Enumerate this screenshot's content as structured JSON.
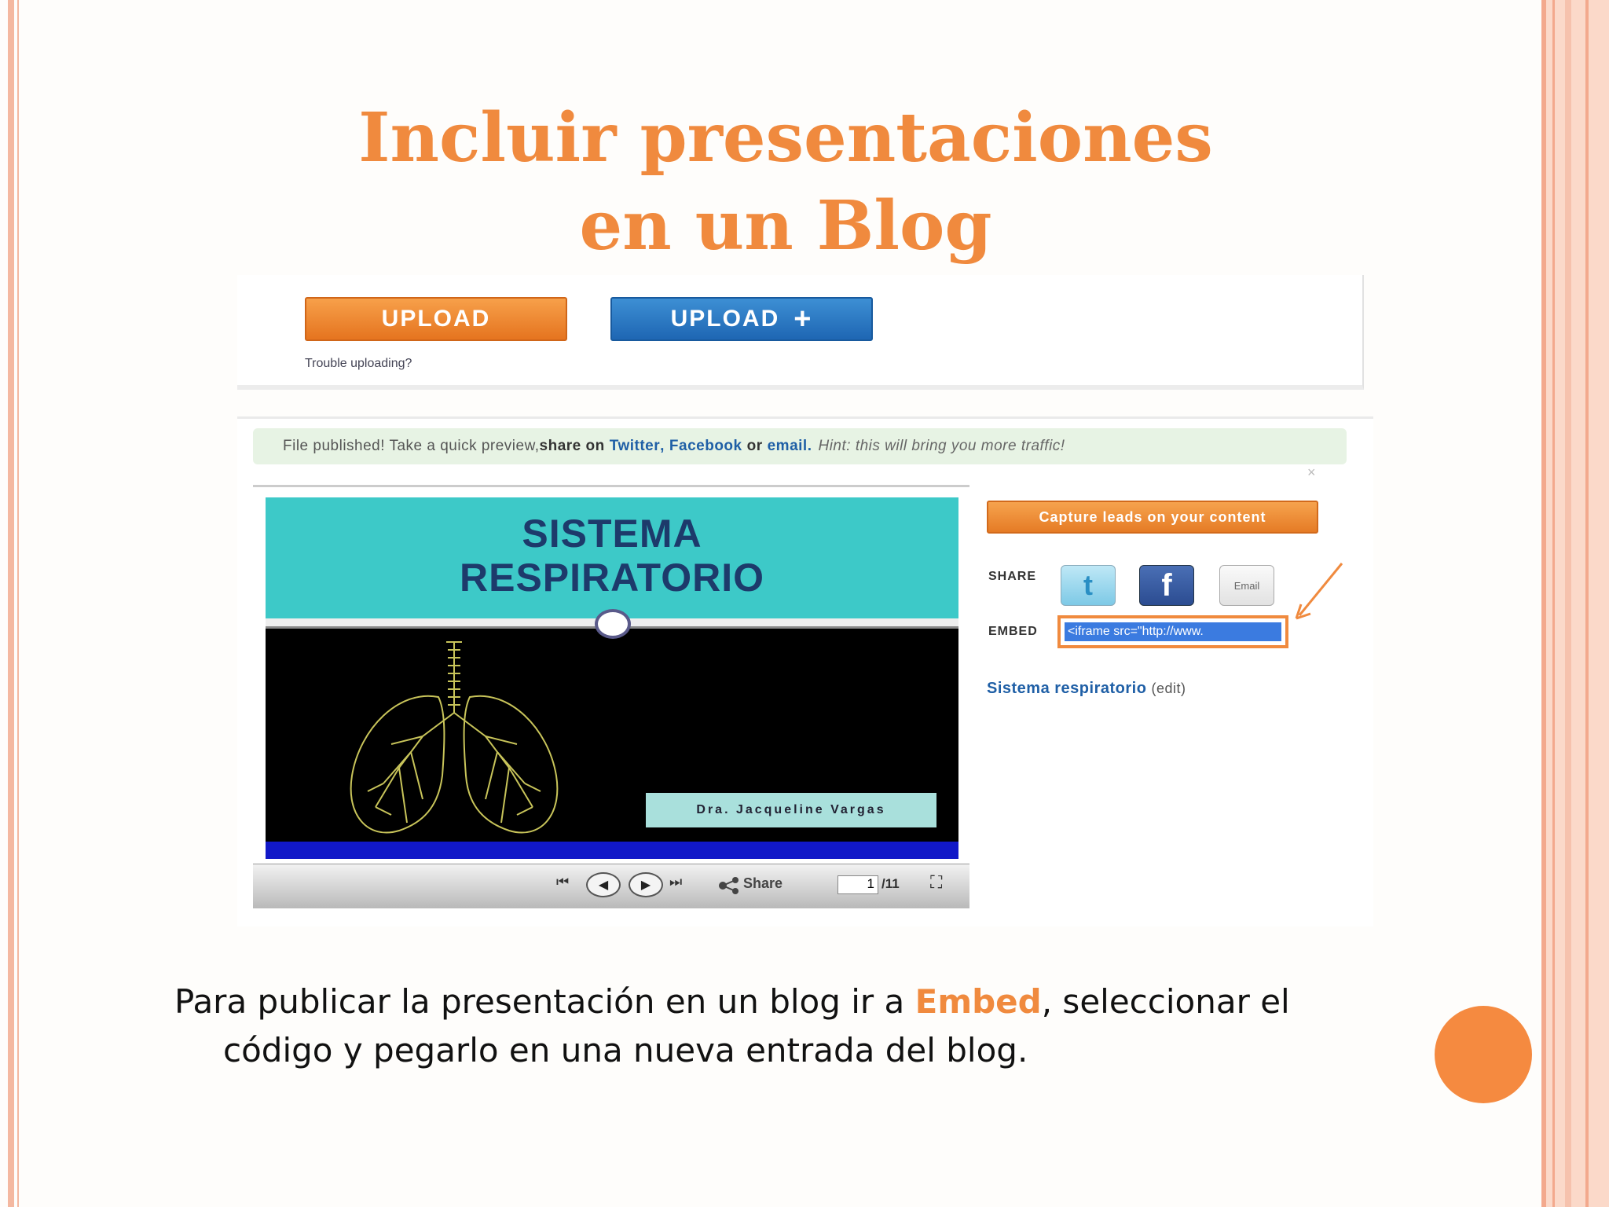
{
  "slide": {
    "title_line1": "Incluir presentaciones",
    "title_line2": "en un Blog",
    "accent_color": "#f08a3e"
  },
  "screenshot": {
    "upload_orange_label": "UPLOAD",
    "upload_blue_label": "UPLOAD",
    "upload_blue_icon": "+",
    "trouble_link": "Trouble uploading?",
    "notice": {
      "text1": "File published! Take a quick preview, ",
      "share_on": "share on",
      "twitter": "Twitter",
      "comma": ",",
      "facebook": "Facebook",
      "or": "or",
      "email": "email.",
      "hint": "Hint: this will bring you more traffic!",
      "close": "×"
    },
    "viewer": {
      "slide_title_line1": "SISTEMA",
      "slide_title_line2": "RESPIRATORIO",
      "author": "Dra. Jacqueline Vargas",
      "controls": {
        "first": "⏮",
        "prev": "◀",
        "next": "▶",
        "last": "⏭",
        "share": "Share",
        "share_icon": "share-icon",
        "current_page": "1",
        "total_pages": "/11",
        "fullscreen": "⛶"
      }
    },
    "capture_button": "Capture leads on your content",
    "share_label": "SHARE",
    "embed_label": "EMBED",
    "social": {
      "twitter": "t",
      "facebook": "f",
      "email": "Email"
    },
    "embed_code": "<iframe src=\"http://www.",
    "presentation_title": "Sistema respiratorio",
    "edit_link": "(edit)"
  },
  "caption": {
    "part1": "Para publicar la presentación en un blog ir a ",
    "highlight": "Embed",
    "part2": ", seleccionar el",
    "line2": "código y pegarlo en una nueva entrada del blog."
  }
}
